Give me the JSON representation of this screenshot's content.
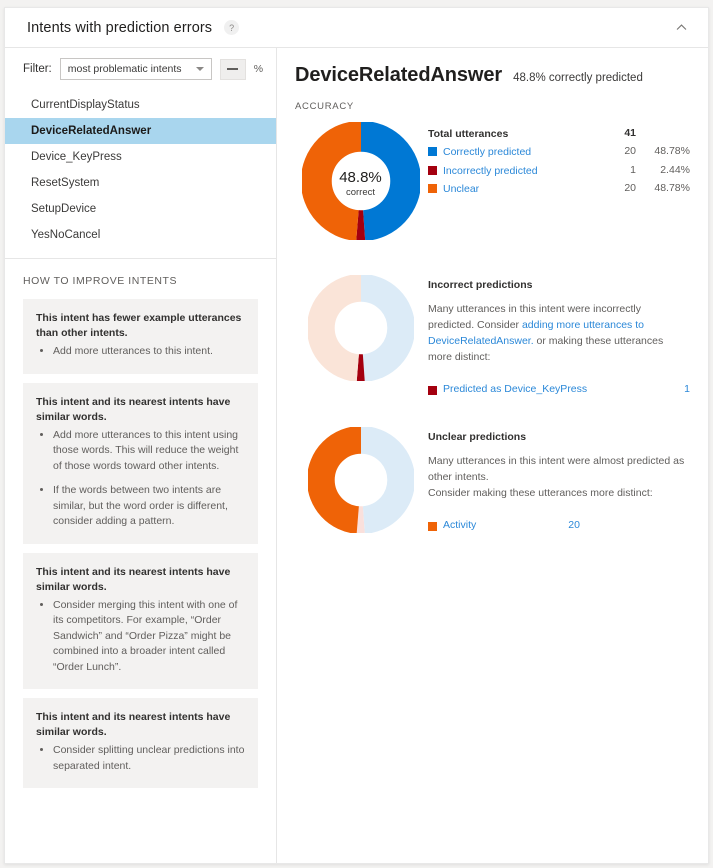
{
  "header": {
    "title": "Intents with prediction errors",
    "help_icon": "question-mark-icon",
    "help_label": "?",
    "collapse_icon": "chevron-up-icon"
  },
  "filter": {
    "label": "Filter:",
    "selected": "most problematic intents",
    "options": [
      "most problematic intents"
    ],
    "threshold_value": "—",
    "threshold_unit": "%"
  },
  "intent_list": {
    "items": [
      {
        "label": "CurrentDisplayStatus",
        "selected": false
      },
      {
        "label": "DeviceRelatedAnswer",
        "selected": true
      },
      {
        "label": "Device_KeyPress",
        "selected": false
      },
      {
        "label": "ResetSystem",
        "selected": false
      },
      {
        "label": "SetupDevice",
        "selected": false
      },
      {
        "label": "YesNoCancel",
        "selected": false
      }
    ]
  },
  "improve": {
    "title": "HOW TO IMPROVE INTENTS",
    "tips": [
      {
        "head": "This intent has fewer example utterances than other intents.",
        "bullets": [
          "Add more utterances to this intent."
        ]
      },
      {
        "head": "This intent and its nearest intents have similar words.",
        "bullets": [
          "Add more utterances to this intent using those words. This will reduce the weight of those words toward other intents.",
          "If the words between two intents are similar, but the word order is different, consider adding a pattern."
        ]
      },
      {
        "head": "This intent and its nearest intents have similar words.",
        "bullets": [
          "Consider merging this intent with one of its competitors. For example, “Order Sandwich” and “Order Pizza” might be combined into a broader intent called “Order Lunch”."
        ]
      },
      {
        "head": "This intent and its nearest intents have similar words.",
        "bullets": [
          "Consider splitting unclear predictions into separated intent."
        ]
      }
    ]
  },
  "detail": {
    "intent_name": "DeviceRelatedAnswer",
    "subtitle": "48.8% correctly predicted",
    "accuracy_label": "ACCURACY",
    "donut_center_pct": "48.8%",
    "donut_center_caption": "correct",
    "legend": {
      "total_label": "Total utterances",
      "total_value": "41",
      "rows": [
        {
          "label": "Correctly predicted",
          "count": "20",
          "pct": "48.78%",
          "color": "#0078d4"
        },
        {
          "label": "Incorrectly predicted",
          "count": "1",
          "pct": "2.44%",
          "color": "#a4000f"
        },
        {
          "label": "Unclear",
          "count": "20",
          "pct": "48.78%",
          "color": "#ef6307"
        }
      ]
    },
    "incorrect": {
      "title": "Incorrect predictions",
      "desc_part1": "Many utterances in this intent were incorrectly predicted. Consider ",
      "desc_link": "adding more utterances to DeviceRelatedAnswer.",
      "desc_part2": " or making these utterances more distinct:",
      "item_label": "Predicted as Device_KeyPress",
      "item_count": "1",
      "item_color": "#a4000f"
    },
    "unclear": {
      "title": "Unclear predictions",
      "desc": "Many utterances in this intent were almost predicted as other intents.\nConsider making these utterances more distinct:",
      "item_label": "Activity",
      "item_count": "20",
      "item_color": "#ef6307"
    }
  },
  "chart_data": [
    {
      "type": "pie",
      "title": "ACCURACY",
      "name": "accuracy-donut",
      "categories": [
        "Correctly predicted",
        "Incorrectly predicted",
        "Unclear"
      ],
      "values": [
        20,
        1,
        20
      ],
      "percentages": [
        48.78,
        2.44,
        48.78
      ],
      "colors": [
        "#0078d4",
        "#a4000f",
        "#ef6307"
      ],
      "total": 41,
      "center_label": "48.8% correct",
      "legend_position": "right",
      "donut": true,
      "inner_radius_ratio": 0.55
    },
    {
      "type": "pie",
      "title": "Incorrect predictions",
      "name": "incorrect-predictions-donut",
      "categories": [
        "Correctly predicted",
        "Incorrectly predicted",
        "Unclear"
      ],
      "values": [
        20,
        1,
        20
      ],
      "percentages": [
        48.78,
        2.44,
        48.78
      ],
      "colors": [
        "#dcebf7",
        "#a4000f",
        "#fae4d8"
      ],
      "highlight": "Incorrectly predicted",
      "total": 41,
      "legend_position": "right",
      "donut": true,
      "inner_radius_ratio": 0.55
    },
    {
      "type": "pie",
      "title": "Unclear predictions",
      "name": "unclear-predictions-donut",
      "categories": [
        "Correctly predicted",
        "Incorrectly predicted",
        "Unclear"
      ],
      "values": [
        20,
        1,
        20
      ],
      "percentages": [
        48.78,
        2.44,
        48.78
      ],
      "colors": [
        "#dcebf7",
        "#fae0dc",
        "#ef6307"
      ],
      "highlight": "Unclear",
      "total": 41,
      "legend_position": "right",
      "donut": true,
      "inner_radius_ratio": 0.55
    }
  ]
}
